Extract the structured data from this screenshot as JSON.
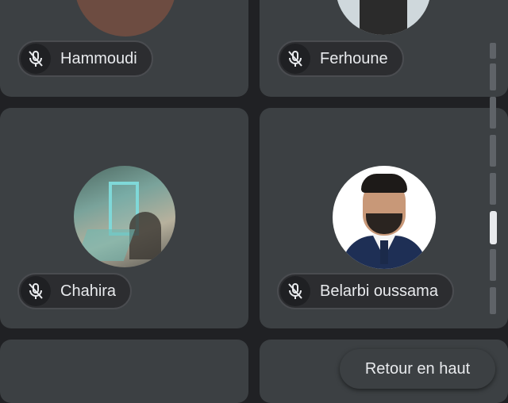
{
  "participants": [
    {
      "name": "Hammoudi",
      "muted": true,
      "avatar": "brown-initial-avatar"
    },
    {
      "name": "Ferhoune",
      "muted": true,
      "avatar": "photo-avatar"
    },
    {
      "name": "Chahira",
      "muted": true,
      "avatar": "photo-avatar"
    },
    {
      "name": "Belarbi oussama",
      "muted": true,
      "avatar": "photo-avatar"
    }
  ],
  "scroll_top_button": {
    "label": "Retour en haut"
  },
  "icons": {
    "mic_off": "mic-off-icon"
  },
  "colors": {
    "background": "#202124",
    "tile": "#3c4043",
    "chip": "#2c2d30",
    "text": "#e8eaed"
  }
}
